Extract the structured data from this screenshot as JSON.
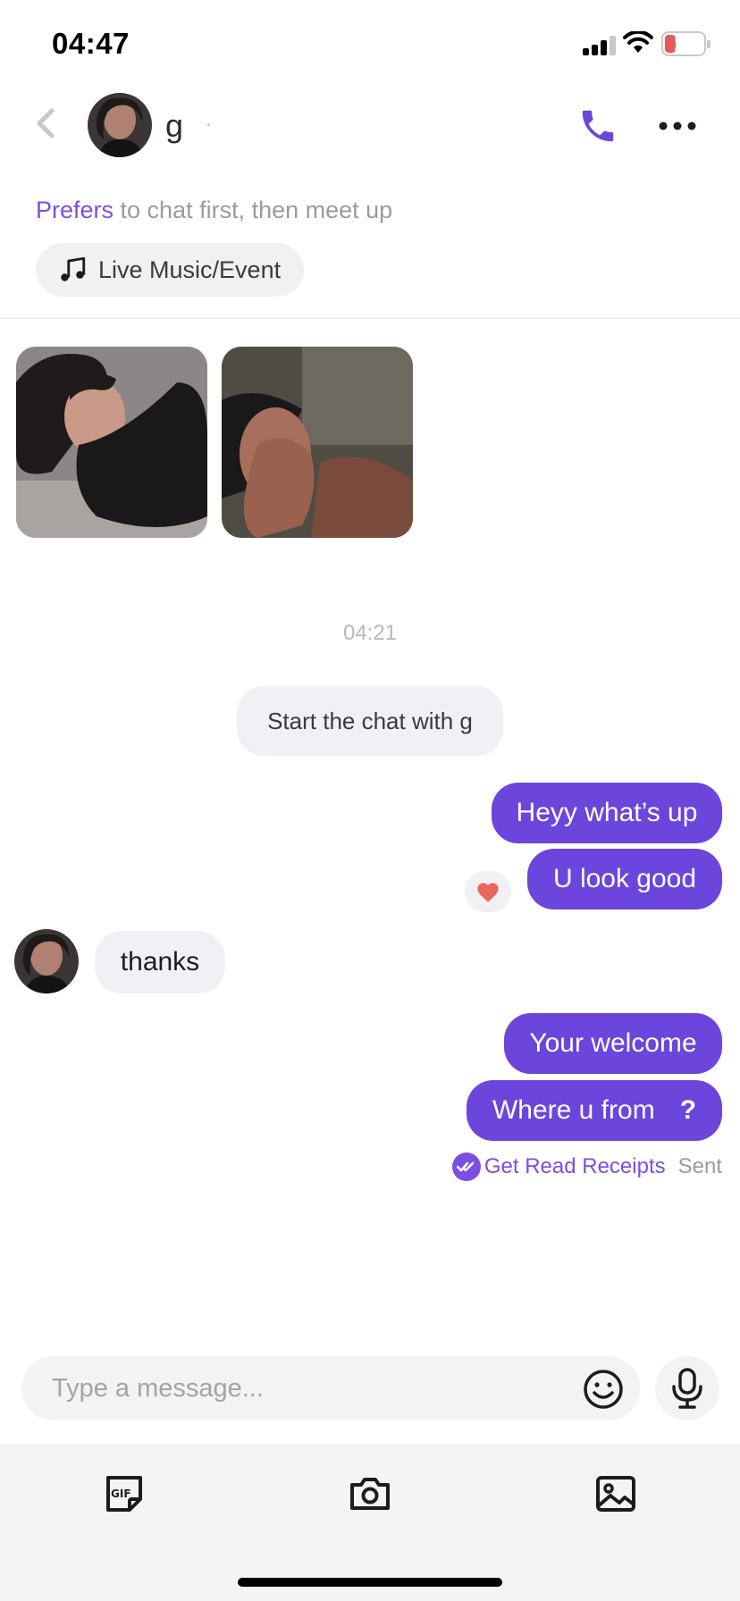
{
  "status_bar": {
    "time": "04:47",
    "battery": "10"
  },
  "header": {
    "contact_name": "g",
    "back_icon": "chevron-left-icon",
    "call_icon": "phone-icon",
    "more_icon": "more-horizontal-icon"
  },
  "profile": {
    "prefers_label": "Prefers",
    "prefers_text": " to chat first, then meet up",
    "interest_chip": "Live Music/Event",
    "interest_icon": "music-note-icon"
  },
  "chat": {
    "timestamp": "04:21",
    "system_message": "Start the chat with g",
    "messages": [
      {
        "direction": "outgoing",
        "text": "Heyy what’s up"
      },
      {
        "direction": "outgoing",
        "text": "U look good",
        "reaction": "heart-icon"
      },
      {
        "direction": "incoming",
        "text": "thanks"
      },
      {
        "direction": "outgoing",
        "text": "Your welcome"
      },
      {
        "direction": "outgoing",
        "text": "Where u from",
        "suffix": "?"
      }
    ],
    "receipts_link": "Get Read Receipts",
    "receipts_status": "Sent"
  },
  "composer": {
    "placeholder": "Type a message...",
    "emoji_icon": "smiley-icon",
    "mic_icon": "microphone-icon"
  },
  "toolbar": {
    "items": [
      "gif-icon",
      "camera-icon",
      "image-icon"
    ]
  },
  "colors": {
    "accent": "#6c45dc",
    "accent_text": "#7b4fe0",
    "bubble_incoming": "#f1f1f5",
    "heart": "#e8675f"
  }
}
